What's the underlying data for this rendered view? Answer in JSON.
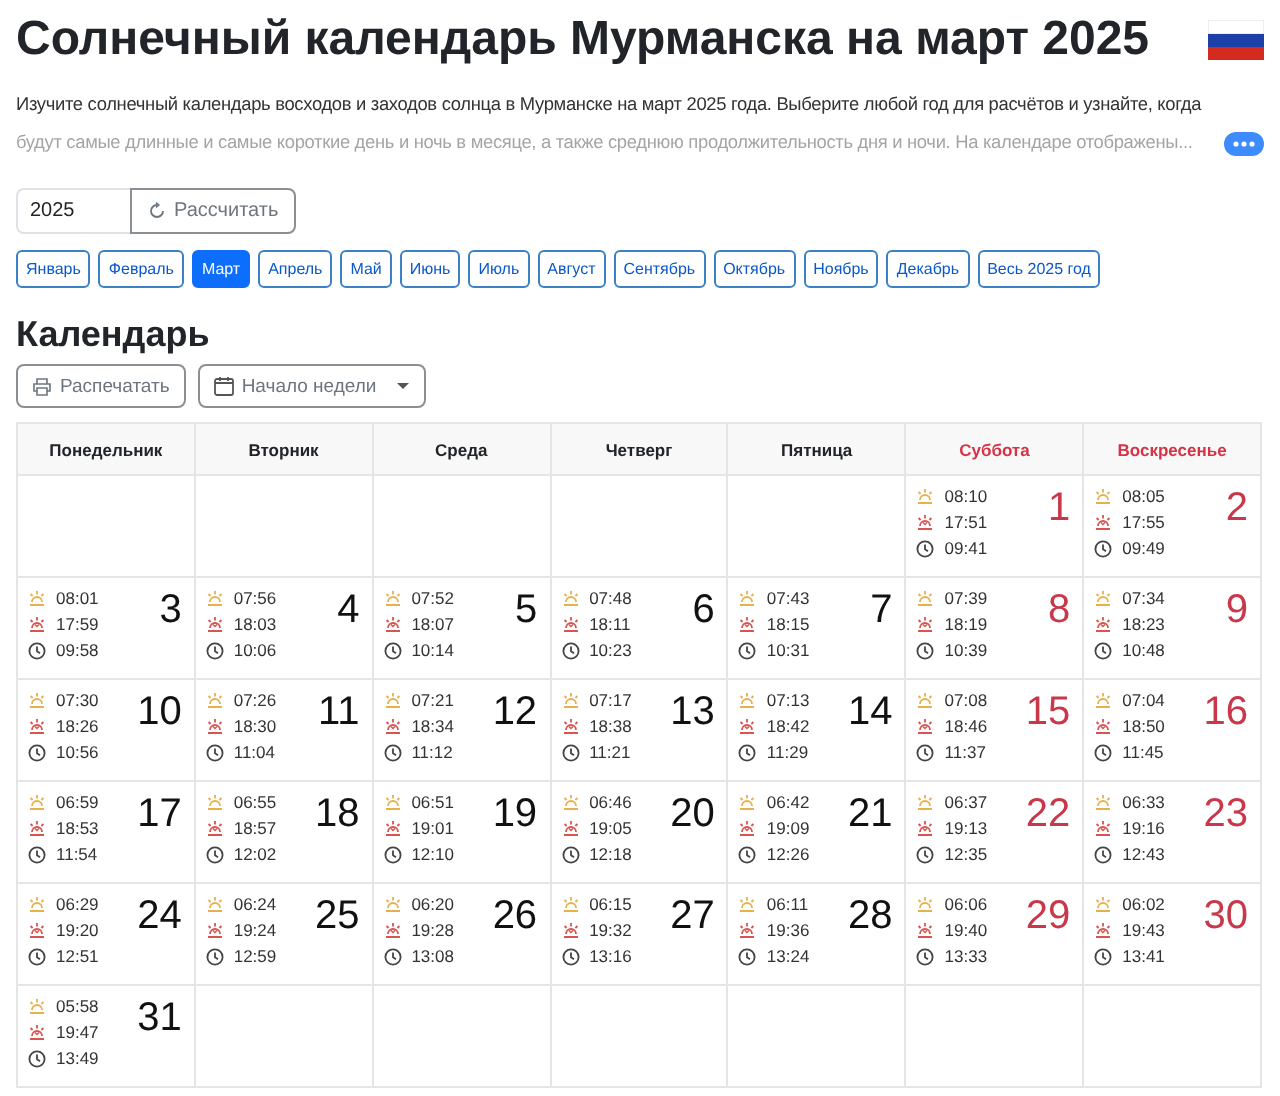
{
  "title": "Солнечный календарь Мурманска на март 2025",
  "intro": "Изучите солнечный календарь восходов и заходов солнца в Мурманске на март 2025 года. Выберите любой год для расчётов и узнайте, когда будут самые длинные и самые короткие день и ночь в месяце, а также среднюю продолжительность дня и ночи. На календаре отображены...",
  "year_field": {
    "value": "2025"
  },
  "calculate_button": "Рассчитать",
  "months": [
    {
      "label": "Январь",
      "selected": false
    },
    {
      "label": "Февраль",
      "selected": false
    },
    {
      "label": "Март",
      "selected": true
    },
    {
      "label": "Апрель",
      "selected": false
    },
    {
      "label": "Май",
      "selected": false
    },
    {
      "label": "Июнь",
      "selected": false
    },
    {
      "label": "Июль",
      "selected": false
    },
    {
      "label": "Август",
      "selected": false
    },
    {
      "label": "Сентябрь",
      "selected": false
    },
    {
      "label": "Октябрь",
      "selected": false
    },
    {
      "label": "Ноябрь",
      "selected": false
    },
    {
      "label": "Декабрь",
      "selected": false
    },
    {
      "label": "Весь 2025 год",
      "selected": false
    }
  ],
  "calendar_heading": "Календарь",
  "print_button": "Распечатать",
  "week_start_button": "Начало недели",
  "weekdays": [
    {
      "label": "Понедельник",
      "weekend": false
    },
    {
      "label": "Вторник",
      "weekend": false
    },
    {
      "label": "Среда",
      "weekend": false
    },
    {
      "label": "Четверг",
      "weekend": false
    },
    {
      "label": "Пятница",
      "weekend": false
    },
    {
      "label": "Суббота",
      "weekend": true
    },
    {
      "label": "Воскресенье",
      "weekend": true
    }
  ],
  "weeks": [
    {
      "days": [
        {
          "kind": "empty"
        },
        {
          "kind": "empty"
        },
        {
          "kind": "empty"
        },
        {
          "kind": "empty"
        },
        {
          "kind": "empty"
        },
        {
          "kind": "day",
          "day": "1",
          "sunrise": "08:10",
          "sunset": "17:51",
          "length": "09:41",
          "weekend": true
        },
        {
          "kind": "day",
          "day": "2",
          "sunrise": "08:05",
          "sunset": "17:55",
          "length": "09:49",
          "weekend": true
        }
      ]
    },
    {
      "days": [
        {
          "kind": "day",
          "day": "3",
          "sunrise": "08:01",
          "sunset": "17:59",
          "length": "09:58",
          "weekend": false
        },
        {
          "kind": "day",
          "day": "4",
          "sunrise": "07:56",
          "sunset": "18:03",
          "length": "10:06",
          "weekend": false
        },
        {
          "kind": "day",
          "day": "5",
          "sunrise": "07:52",
          "sunset": "18:07",
          "length": "10:14",
          "weekend": false
        },
        {
          "kind": "day",
          "day": "6",
          "sunrise": "07:48",
          "sunset": "18:11",
          "length": "10:23",
          "weekend": false
        },
        {
          "kind": "day",
          "day": "7",
          "sunrise": "07:43",
          "sunset": "18:15",
          "length": "10:31",
          "weekend": false
        },
        {
          "kind": "day",
          "day": "8",
          "sunrise": "07:39",
          "sunset": "18:19",
          "length": "10:39",
          "weekend": true
        },
        {
          "kind": "day",
          "day": "9",
          "sunrise": "07:34",
          "sunset": "18:23",
          "length": "10:48",
          "weekend": true
        }
      ]
    },
    {
      "days": [
        {
          "kind": "day",
          "day": "10",
          "sunrise": "07:30",
          "sunset": "18:26",
          "length": "10:56",
          "weekend": false
        },
        {
          "kind": "day",
          "day": "11",
          "sunrise": "07:26",
          "sunset": "18:30",
          "length": "11:04",
          "weekend": false
        },
        {
          "kind": "day",
          "day": "12",
          "sunrise": "07:21",
          "sunset": "18:34",
          "length": "11:12",
          "weekend": false
        },
        {
          "kind": "day",
          "day": "13",
          "sunrise": "07:17",
          "sunset": "18:38",
          "length": "11:21",
          "weekend": false
        },
        {
          "kind": "day",
          "day": "14",
          "sunrise": "07:13",
          "sunset": "18:42",
          "length": "11:29",
          "weekend": false
        },
        {
          "kind": "day",
          "day": "15",
          "sunrise": "07:08",
          "sunset": "18:46",
          "length": "11:37",
          "weekend": true
        },
        {
          "kind": "day",
          "day": "16",
          "sunrise": "07:04",
          "sunset": "18:50",
          "length": "11:45",
          "weekend": true
        }
      ]
    },
    {
      "days": [
        {
          "kind": "day",
          "day": "17",
          "sunrise": "06:59",
          "sunset": "18:53",
          "length": "11:54",
          "weekend": false
        },
        {
          "kind": "day",
          "day": "18",
          "sunrise": "06:55",
          "sunset": "18:57",
          "length": "12:02",
          "weekend": false
        },
        {
          "kind": "day",
          "day": "19",
          "sunrise": "06:51",
          "sunset": "19:01",
          "length": "12:10",
          "weekend": false
        },
        {
          "kind": "day",
          "day": "20",
          "sunrise": "06:46",
          "sunset": "19:05",
          "length": "12:18",
          "weekend": false
        },
        {
          "kind": "day",
          "day": "21",
          "sunrise": "06:42",
          "sunset": "19:09",
          "length": "12:26",
          "weekend": false
        },
        {
          "kind": "day",
          "day": "22",
          "sunrise": "06:37",
          "sunset": "19:13",
          "length": "12:35",
          "weekend": true
        },
        {
          "kind": "day",
          "day": "23",
          "sunrise": "06:33",
          "sunset": "19:16",
          "length": "12:43",
          "weekend": true
        }
      ]
    },
    {
      "days": [
        {
          "kind": "day",
          "day": "24",
          "sunrise": "06:29",
          "sunset": "19:20",
          "length": "12:51",
          "weekend": false
        },
        {
          "kind": "day",
          "day": "25",
          "sunrise": "06:24",
          "sunset": "19:24",
          "length": "12:59",
          "weekend": false
        },
        {
          "kind": "day",
          "day": "26",
          "sunrise": "06:20",
          "sunset": "19:28",
          "length": "13:08",
          "weekend": false
        },
        {
          "kind": "day",
          "day": "27",
          "sunrise": "06:15",
          "sunset": "19:32",
          "length": "13:16",
          "weekend": false
        },
        {
          "kind": "day",
          "day": "28",
          "sunrise": "06:11",
          "sunset": "19:36",
          "length": "13:24",
          "weekend": false
        },
        {
          "kind": "day",
          "day": "29",
          "sunrise": "06:06",
          "sunset": "19:40",
          "length": "13:33",
          "weekend": true
        },
        {
          "kind": "day",
          "day": "30",
          "sunrise": "06:02",
          "sunset": "19:43",
          "length": "13:41",
          "weekend": true
        }
      ]
    },
    {
      "days": [
        {
          "kind": "day",
          "day": "31",
          "sunrise": "05:58",
          "sunset": "19:47",
          "length": "13:49",
          "weekend": false
        },
        {
          "kind": "empty"
        },
        {
          "kind": "empty"
        },
        {
          "kind": "empty"
        },
        {
          "kind": "empty"
        },
        {
          "kind": "empty"
        },
        {
          "kind": "empty"
        }
      ]
    }
  ]
}
